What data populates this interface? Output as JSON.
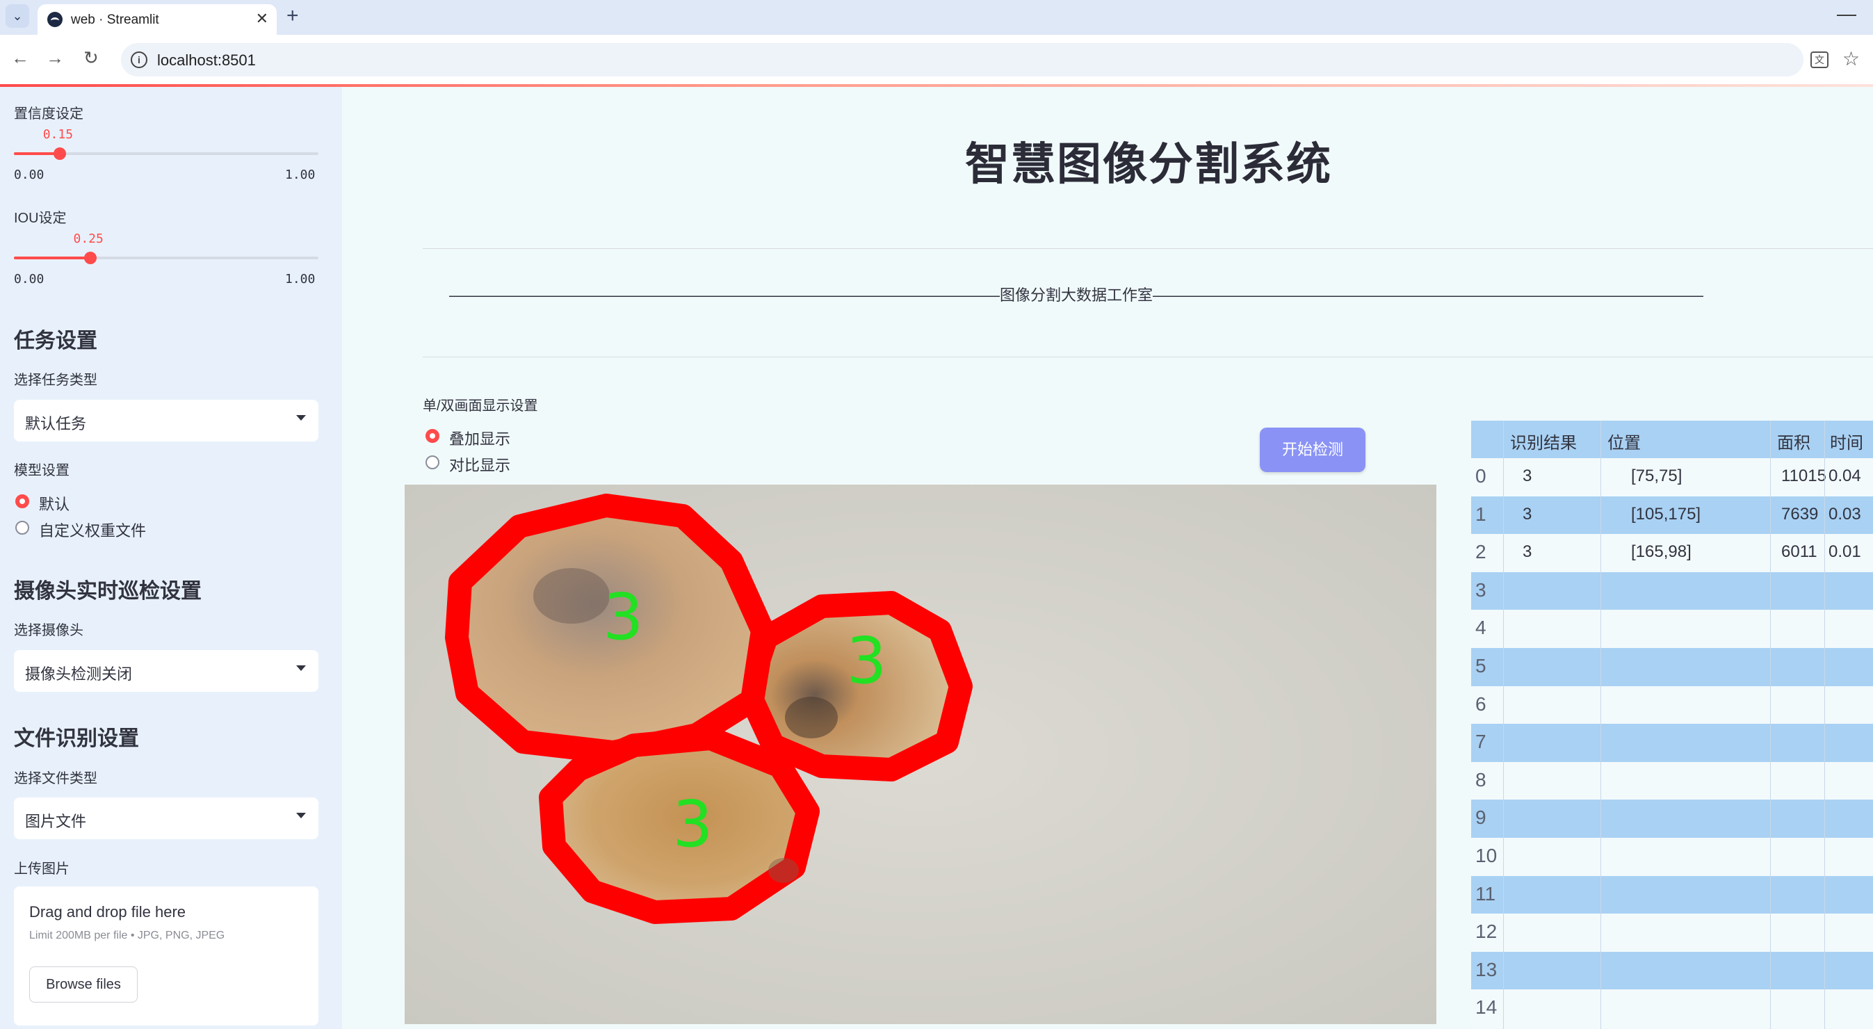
{
  "browser": {
    "tab_title": "web · Streamlit",
    "url": "localhost:8501"
  },
  "sidebar": {
    "confidence": {
      "label": "置信度设定",
      "value": "0.15",
      "min": "0.00",
      "max": "1.00",
      "fraction": 0.15
    },
    "iou": {
      "label": "IOU设定",
      "value": "0.25",
      "min": "0.00",
      "max": "1.00",
      "fraction": 0.25
    },
    "task_header": "任务设置",
    "task_type_label": "选择任务类型",
    "task_type_value": "默认任务",
    "model_label": "模型设置",
    "model_options": [
      "默认",
      "自定义权重文件"
    ],
    "model_selected": "默认",
    "camera_header": "摄像头实时巡检设置",
    "camera_label": "选择摄像头",
    "camera_value": "摄像头检测关闭",
    "file_header": "文件识别设置",
    "file_type_label": "选择文件类型",
    "file_type_value": "图片文件",
    "upload_label": "上传图片",
    "upload_title": "Drag and drop file here",
    "upload_limit": "Limit 200MB per file • JPG, PNG, JPEG",
    "browse_label": "Browse files"
  },
  "main": {
    "title": "智慧图像分割系统",
    "subtitle": "————————————————————————————————————图像分割大数据工作室————————————————————————————————————",
    "display_label": "单/双画面显示设置",
    "display_options": [
      "叠加显示",
      "对比显示"
    ],
    "display_selected": "叠加显示",
    "start_button": "开始检测",
    "detections": [
      {
        "label": "3"
      },
      {
        "label": "3"
      },
      {
        "label": "3"
      }
    ]
  },
  "table": {
    "columns": [
      "识别结果",
      "位置",
      "面积",
      "时间"
    ],
    "rows": [
      {
        "index": "0",
        "result": "3",
        "position": "[75,75]",
        "area": "11015",
        "time": "0.04"
      },
      {
        "index": "1",
        "result": "3",
        "position": "[105,175]",
        "area": "7639",
        "time": "0.03"
      },
      {
        "index": "2",
        "result": "3",
        "position": "[165,98]",
        "area": "6011",
        "time": "0.01"
      },
      {
        "index": "3",
        "result": "",
        "position": "",
        "area": "",
        "time": ""
      },
      {
        "index": "4",
        "result": "",
        "position": "",
        "area": "",
        "time": ""
      },
      {
        "index": "5",
        "result": "",
        "position": "",
        "area": "",
        "time": ""
      },
      {
        "index": "6",
        "result": "",
        "position": "",
        "area": "",
        "time": ""
      },
      {
        "index": "7",
        "result": "",
        "position": "",
        "area": "",
        "time": ""
      },
      {
        "index": "8",
        "result": "",
        "position": "",
        "area": "",
        "time": ""
      },
      {
        "index": "9",
        "result": "",
        "position": "",
        "area": "",
        "time": ""
      },
      {
        "index": "10",
        "result": "",
        "position": "",
        "area": "",
        "time": ""
      },
      {
        "index": "11",
        "result": "",
        "position": "",
        "area": "",
        "time": ""
      },
      {
        "index": "12",
        "result": "",
        "position": "",
        "area": "",
        "time": ""
      },
      {
        "index": "13",
        "result": "",
        "position": "",
        "area": "",
        "time": ""
      },
      {
        "index": "14",
        "result": "",
        "position": "",
        "area": "",
        "time": ""
      }
    ]
  },
  "colors": {
    "accent": "#ff4b4b",
    "sidebar_bg": "#e8f1fb",
    "table_stripe": "#a9d1f3",
    "start_button": "#8a93f5",
    "mask_outline": "#ff0000",
    "label_text": "#22e022"
  }
}
